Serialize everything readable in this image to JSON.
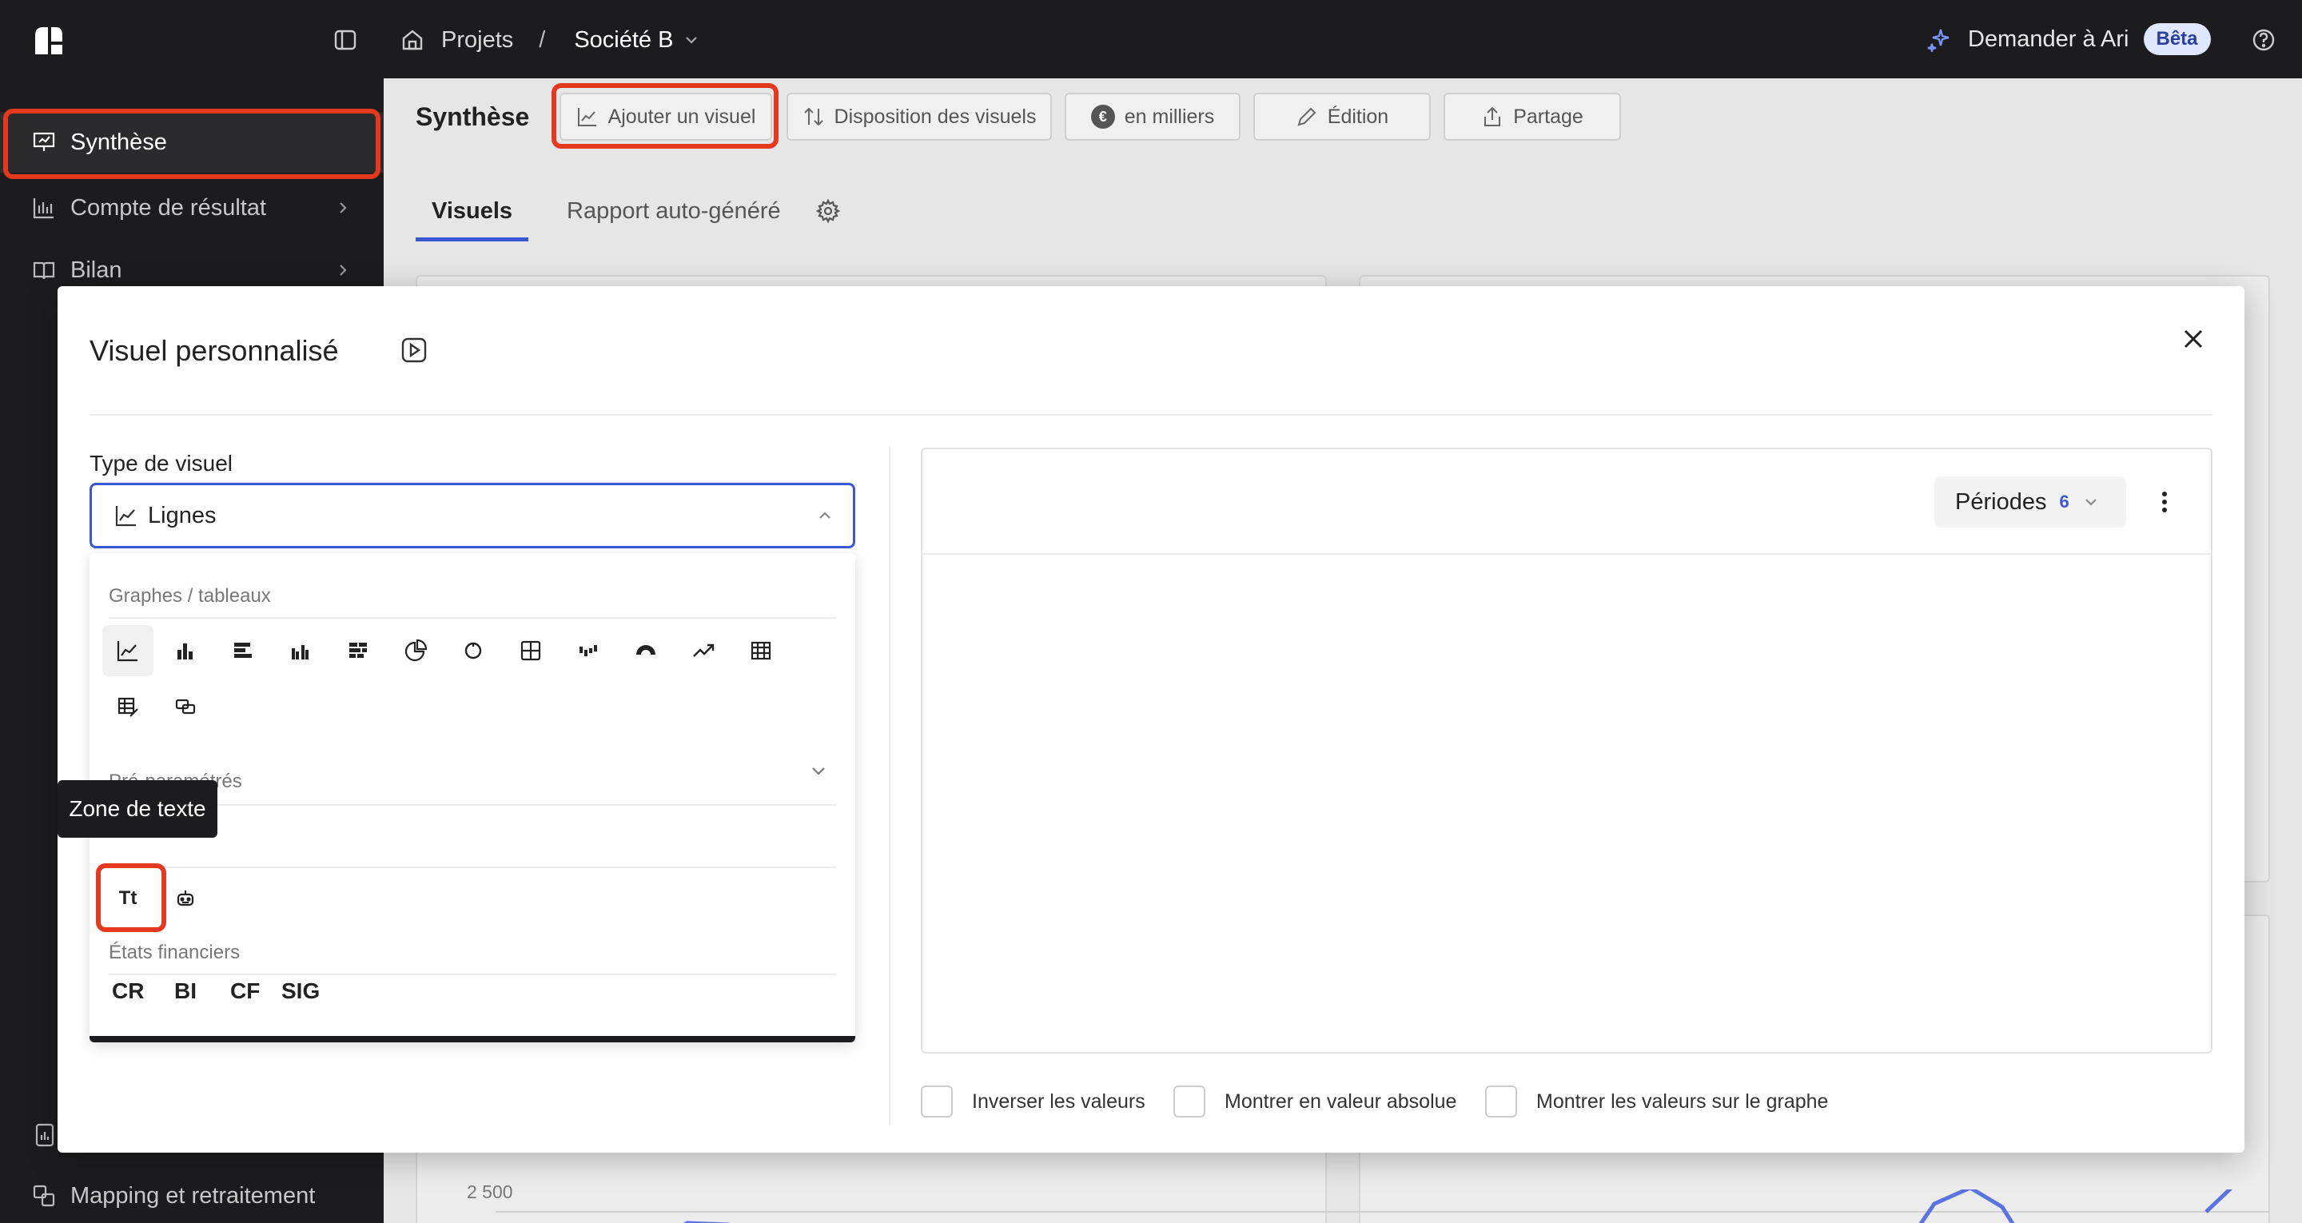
{
  "topbar": {
    "breadcrumb_projects": "Projets",
    "breadcrumb_sep": "/",
    "company": "Société B",
    "ask_label": "Demander à Ari",
    "beta_badge": "Bêta"
  },
  "sidebar": {
    "items": [
      {
        "label": "Synthèse",
        "icon": "presentation-icon"
      },
      {
        "label": "Compte de résultat",
        "icon": "bar-chart-icon"
      },
      {
        "label": "Bilan",
        "icon": "book-icon"
      },
      {
        "label": "Mapping et retraitement",
        "icon": "mapping-icon"
      }
    ]
  },
  "main": {
    "title": "Synthèse",
    "toolbar": {
      "add_visual": "Ajouter un visuel",
      "layout": "Disposition des visuels",
      "units": "en milliers",
      "edit": "Édition",
      "share": "Partage",
      "euro_symbol": "€"
    },
    "tabs": [
      "Visuels",
      "Rapport auto-généré"
    ],
    "chart_tick": "2 500"
  },
  "modal": {
    "title": "Visuel personnalisé",
    "type_label": "Type de visuel",
    "selected_type": "Lignes",
    "sections": {
      "charts": "Graphes / tableaux",
      "presets": "Pré-paramétrés",
      "financial": "États financiers"
    },
    "text_icon_label": "Tt",
    "tooltip": "Zone de texte",
    "financial_items": [
      "CR",
      "BI",
      "CF",
      "SIG"
    ],
    "periods_label": "Périodes",
    "periods_count": "6",
    "options": [
      "Inverser les valeurs",
      "Montrer en valeur absolue",
      "Montrer les valeurs sur le graphe"
    ]
  },
  "colors": {
    "accent": "#3a57d6",
    "highlight": "#e5381f",
    "dark_bg": "#1c1c1e"
  }
}
